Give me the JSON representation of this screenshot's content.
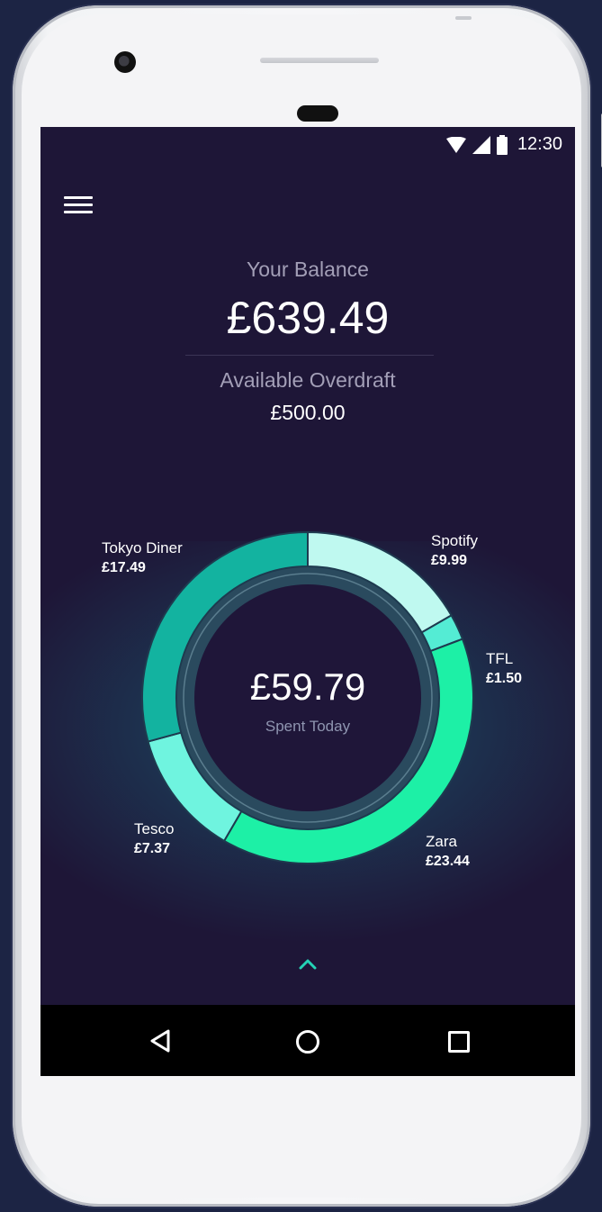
{
  "status_bar": {
    "time": "12:30"
  },
  "balance": {
    "label": "Your Balance",
    "value": "£639.49",
    "overdraft_label": "Available Overdraft",
    "overdraft_value": "£500.00"
  },
  "spending": {
    "total": "£59.79",
    "total_label": "Spent Today",
    "segments": [
      {
        "name": "Spotify",
        "amount": "£9.99",
        "value": 9.99,
        "color": "#bff9f0"
      },
      {
        "name": "TFL",
        "amount": "£1.50",
        "value": 1.5,
        "color": "#54ecd4"
      },
      {
        "name": "Zara",
        "amount": "£23.44",
        "value": 23.44,
        "color": "#1df0a6"
      },
      {
        "name": "Tesco",
        "amount": "£7.37",
        "value": 7.37,
        "color": "#6ff4df"
      },
      {
        "name": "Tokyo Diner",
        "amount": "£17.49",
        "value": 17.49,
        "color": "#13b3a0"
      }
    ]
  },
  "icons": {
    "menu": "hamburger-icon",
    "expand": "chevron-up-icon",
    "nav": [
      "back-icon",
      "home-icon",
      "recents-icon"
    ]
  },
  "colors": {
    "screen_background": "#1e1637",
    "accent": "#1df0a6"
  }
}
